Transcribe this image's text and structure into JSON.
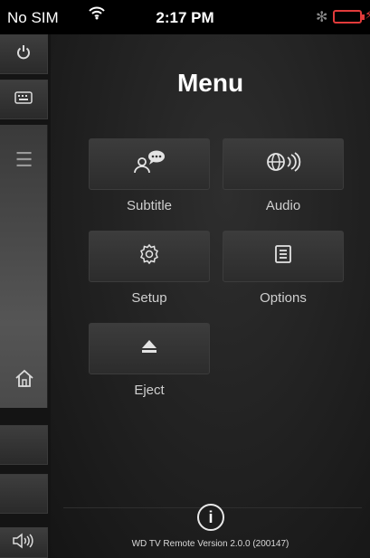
{
  "status_bar": {
    "carrier": "No SIM",
    "time": "2:17 PM",
    "wifi_icon": "wifi-icon",
    "bluetooth_icon": "bluetooth-icon",
    "battery_icon": "battery-icon",
    "battery_color": "#e23b3b"
  },
  "sidebar": {
    "power_icon": "power-icon",
    "keyboard_icon": "keyboard-icon",
    "menu_icon": "menu-lines-icon",
    "home_icon": "home-icon",
    "volume_icon": "volume-icon"
  },
  "menu": {
    "title": "Menu",
    "items": [
      {
        "label": "Subtitle",
        "icon": "subtitle-icon"
      },
      {
        "label": "Audio",
        "icon": "audio-icon"
      },
      {
        "label": "Setup",
        "icon": "gear-icon"
      },
      {
        "label": "Options",
        "icon": "options-icon"
      },
      {
        "label": "Eject",
        "icon": "eject-icon"
      }
    ]
  },
  "footer": {
    "info_label": "i",
    "version": "WD TV Remote Version 2.0.0 (200147)"
  }
}
